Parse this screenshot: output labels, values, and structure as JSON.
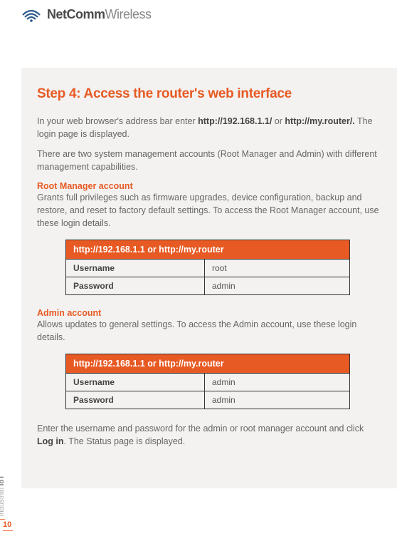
{
  "brand": {
    "name_bold": "NetComm",
    "name_light": "Wireless"
  },
  "step": {
    "title": "Step 4: Access the router's web interface",
    "intro_pre": "In your web browser's address bar enter ",
    "intro_url1": "http://192.168.1.1/",
    "intro_mid": " or ",
    "intro_url2": "http://my.router/.",
    "intro_post": " The login page is displayed.",
    "accounts_intro": "There are two system management accounts (Root Manager and Admin) with different management capabilities.",
    "root": {
      "heading": "Root Manager account",
      "text": "Grants full privileges such as firmware upgrades, device configuration, backup and restore, and reset to factory default settings. To access the Root Manager account, use these login details.",
      "table_head": "http://192.168.1.1 or http://my.router",
      "username_label": "Username",
      "username_value": "root",
      "password_label": "Password",
      "password_value": "admin"
    },
    "admin": {
      "heading": "Admin account",
      "text": "Allows updates to general settings. To access the Admin account, use these login details.",
      "table_head": "http://192.168.1.1 or http://my.router",
      "username_label": "Username",
      "username_value": "admin",
      "password_label": "Password",
      "password_value": "admin"
    },
    "footer_pre": "Enter the username and password for the admin or root manager account and click ",
    "footer_bold": "Log in",
    "footer_post": ". The Status page is displayed."
  },
  "side": {
    "divider": "| ",
    "text1": "Industrial ",
    "text2": "IoT",
    "page_num": "10"
  }
}
